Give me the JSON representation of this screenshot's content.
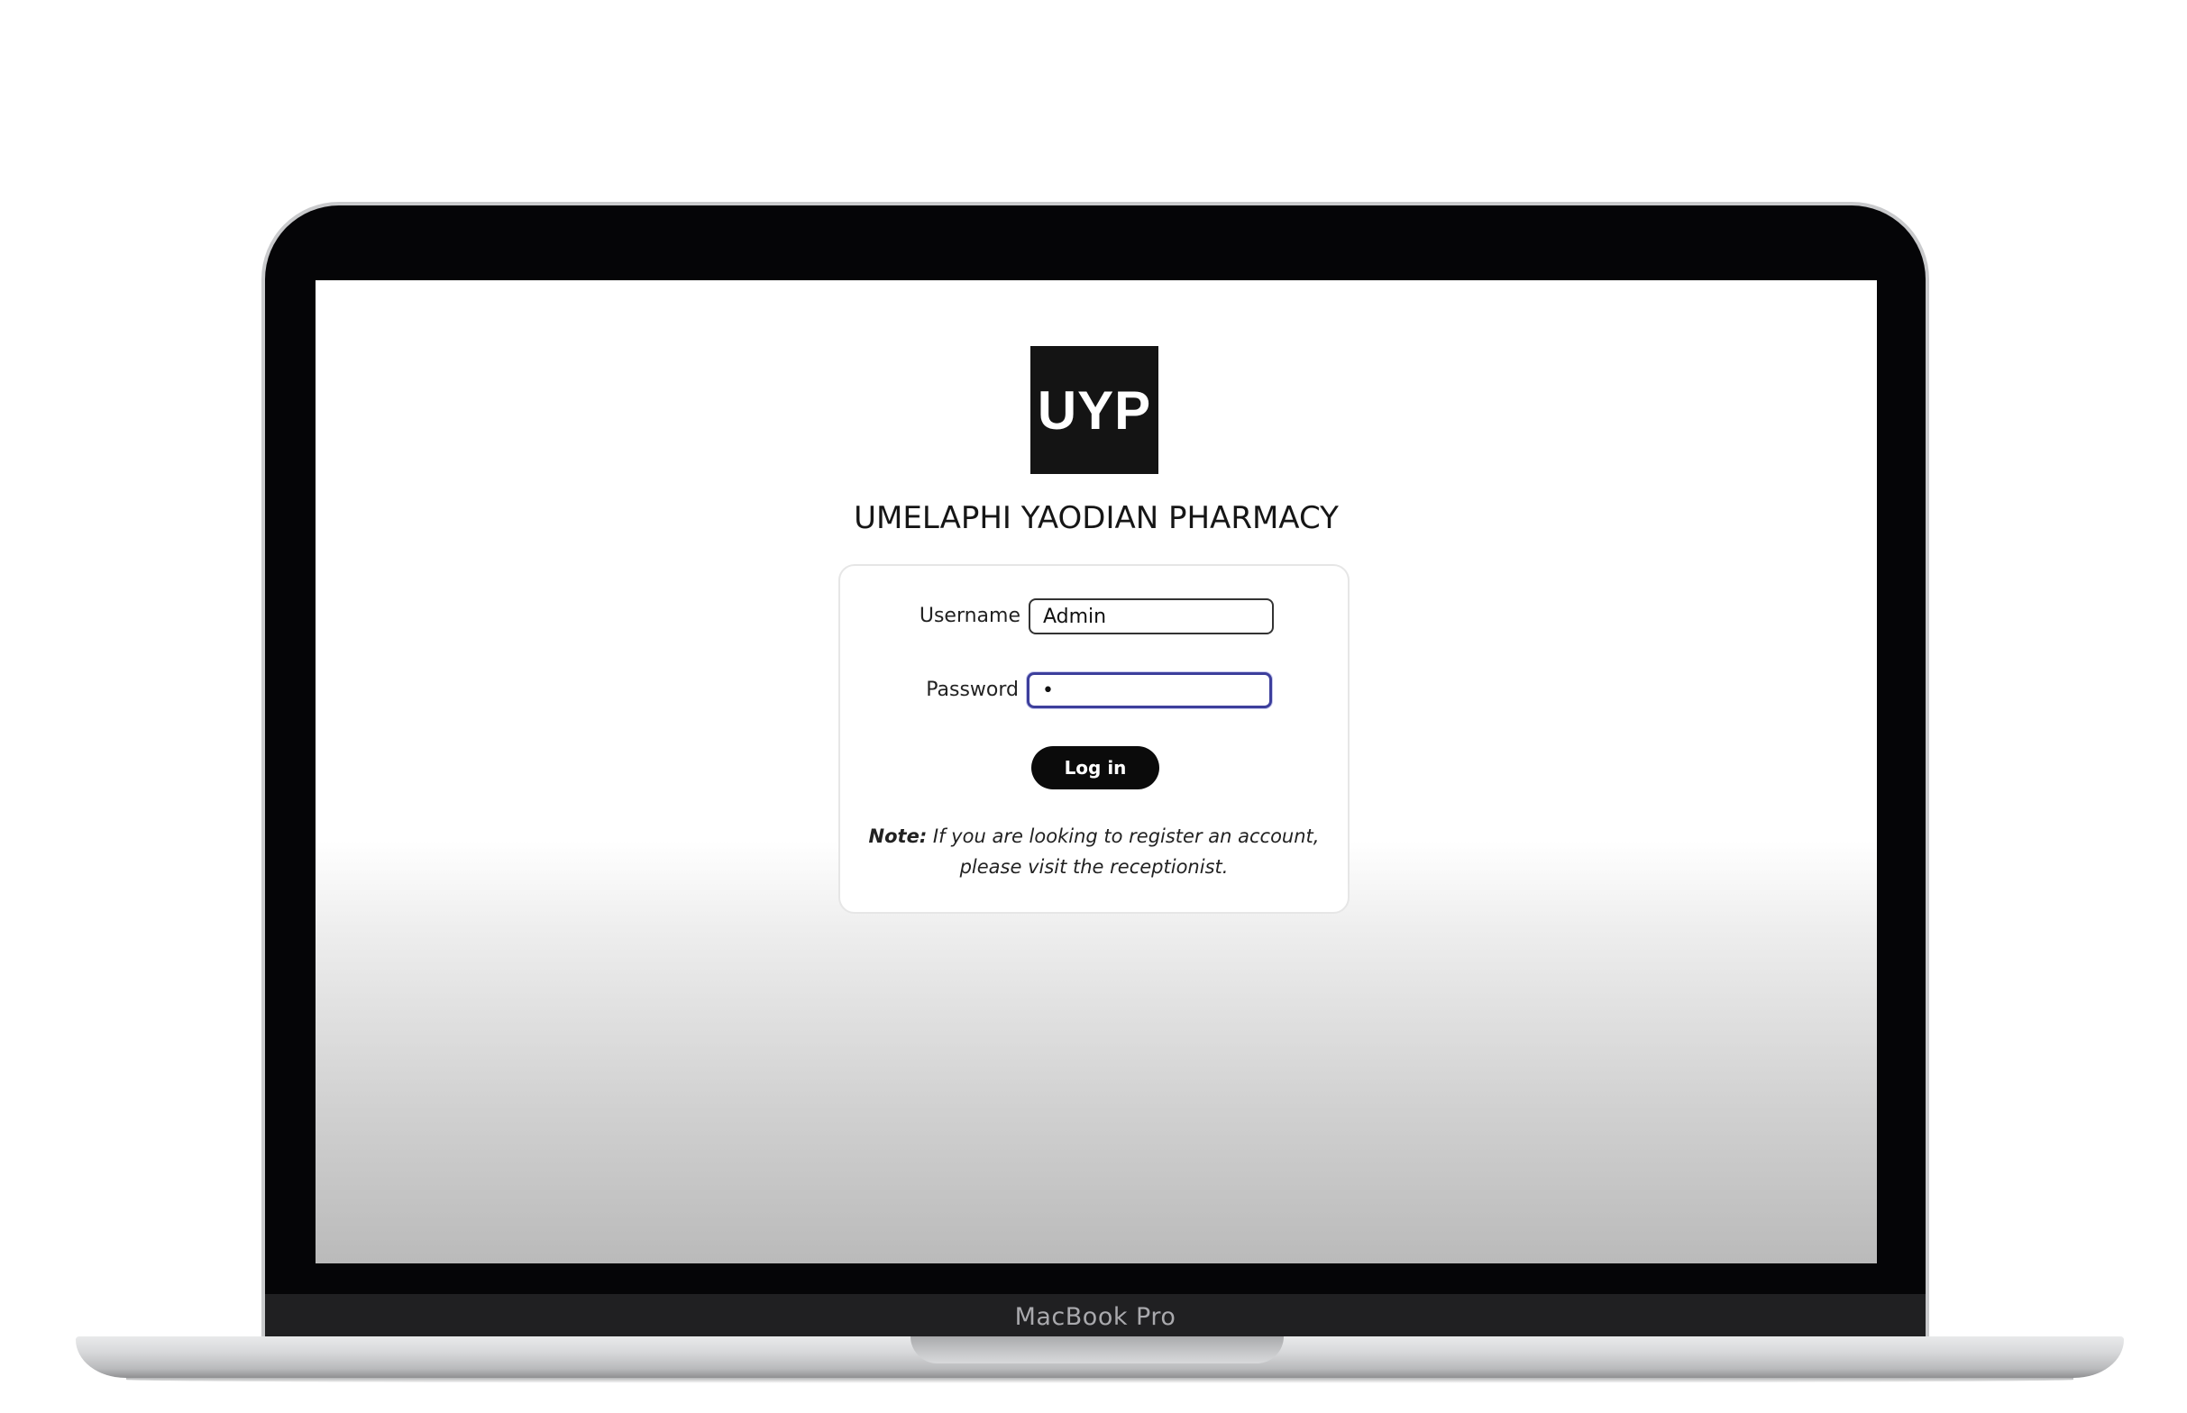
{
  "device": {
    "brand_label": "MacBook Pro"
  },
  "page": {
    "logo_text": "UYP",
    "title": "UMELAPHI YAODIAN PHARMACY"
  },
  "login_form": {
    "username_label": "Username",
    "username_value": "Admin",
    "password_label": "Password",
    "password_value": "•",
    "login_button_label": "Log in",
    "note_prefix": "Note:",
    "note_line1": "If you are looking to register an account,",
    "note_line2": "please visit the receptionist."
  },
  "colors": {
    "logo_background": "#141414",
    "button_background": "#0b0b0b",
    "focus_ring": "#3d3f9c"
  }
}
